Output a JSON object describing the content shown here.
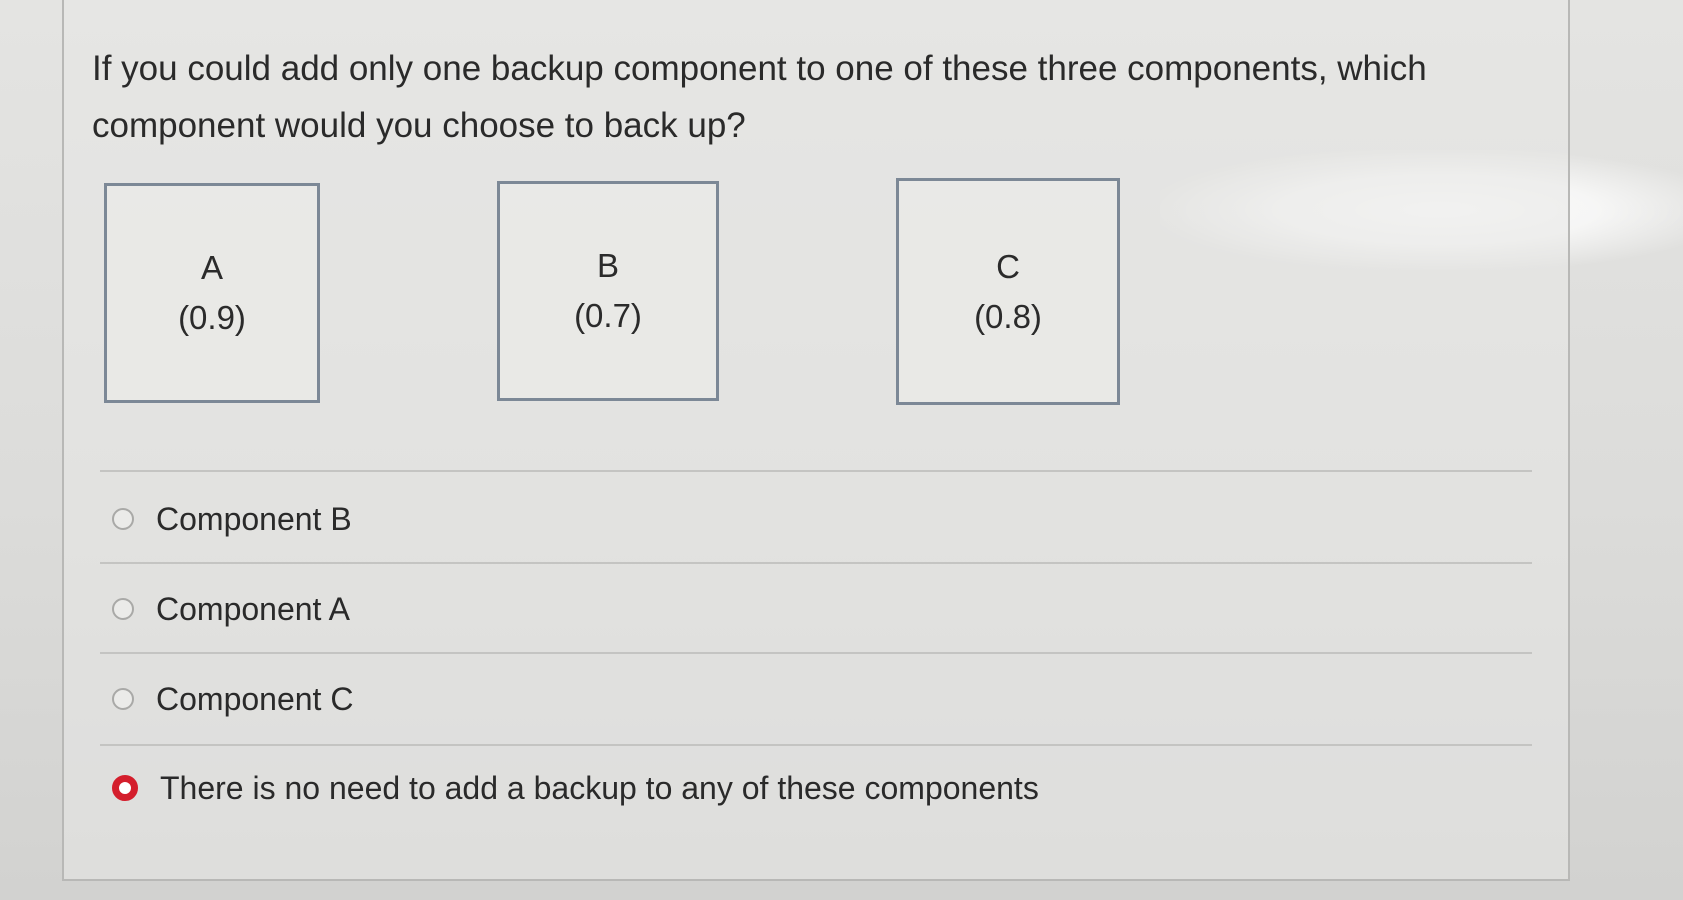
{
  "question": {
    "text": "If you could add only one backup component to one of these three components, which component would you choose to back up?"
  },
  "components": [
    {
      "name": "A",
      "reliability": "(0.9)"
    },
    {
      "name": "B",
      "reliability": "(0.7)"
    },
    {
      "name": "C",
      "reliability": "(0.8)"
    }
  ],
  "options": [
    {
      "label": "Component B",
      "selected": false
    },
    {
      "label": "Component A",
      "selected": false
    },
    {
      "label": "Component C",
      "selected": false
    },
    {
      "label": "There is no need to add a backup to any of these components",
      "selected": true
    }
  ],
  "colors": {
    "selected_radio": "#d41e2c",
    "box_border": "#7c8896"
  }
}
